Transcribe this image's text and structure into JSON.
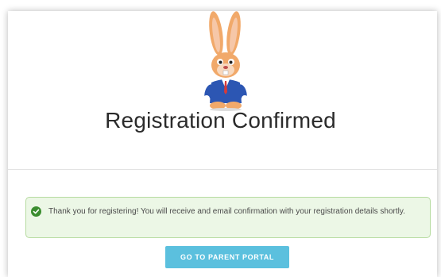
{
  "page": {
    "title": "Registration Confirmed"
  },
  "logo": {
    "icon": "bunny-mascot-icon"
  },
  "alert": {
    "icon": "check-circle-icon",
    "text": "Thank you for registering! You will receive and email confirmation with your registration details shortly.",
    "color": "#ecf7e6"
  },
  "actions": {
    "portal_button_label": "GO TO PARENT PORTAL",
    "button_color": "#5bc0de"
  }
}
